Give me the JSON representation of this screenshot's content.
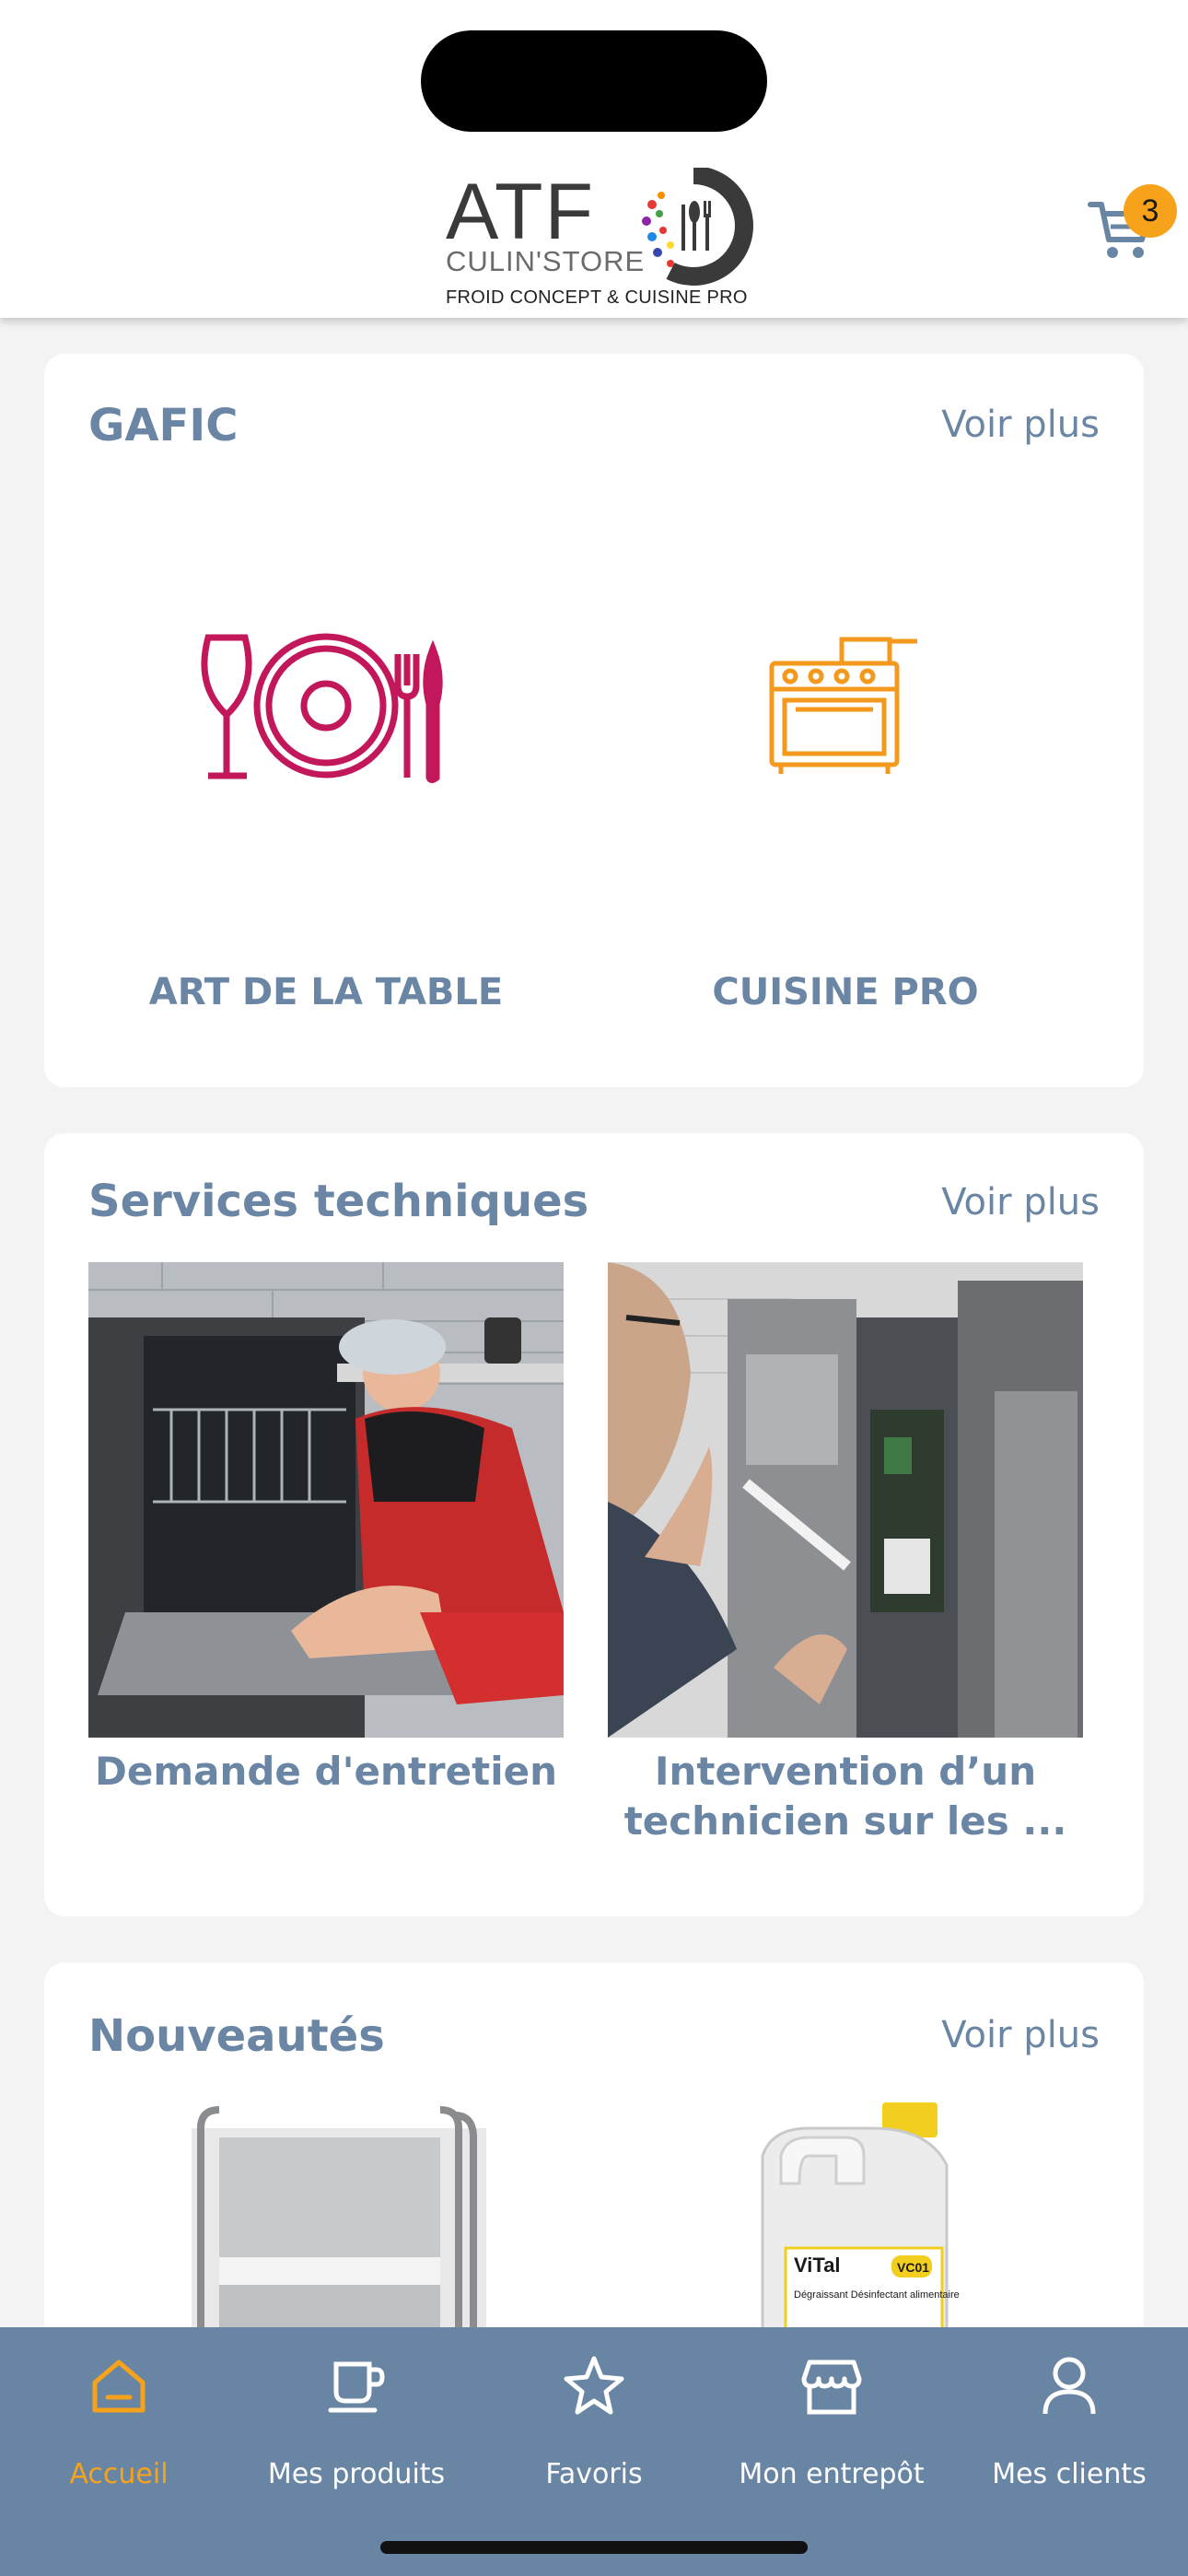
{
  "header": {
    "logo": {
      "brand": "ATF",
      "sub": "CULIN'STORE",
      "tagline": "FROID CONCEPT & CUISINE PRO"
    },
    "cart_count": "3",
    "icons": [
      "cart-icon"
    ]
  },
  "gafic": {
    "title": "GAFIC",
    "more": "Voir plus",
    "categories": [
      {
        "label": "ART DE LA TABLE",
        "icon": "tableware-icon",
        "color": "#c2185b"
      },
      {
        "label": "CUISINE PRO",
        "icon": "stove-icon",
        "color": "#f39a1e"
      }
    ]
  },
  "services": {
    "title": "Services techniques",
    "more": "Voir plus",
    "items": [
      {
        "label": "Demande d'entretien"
      },
      {
        "label": "Intervention d’un technicien sur les ..."
      }
    ]
  },
  "news": {
    "title": "Nouveautés",
    "more": "Voir plus",
    "products": [
      {
        "name": "trolley-product"
      },
      {
        "name": "detergent-product",
        "brand": "ViTal",
        "code": "VC01",
        "text": "Dégraissant Désinfectant alimentaire"
      }
    ]
  },
  "nav": {
    "items": [
      {
        "label": "Accueil",
        "icon": "home-icon",
        "active": true
      },
      {
        "label": "Mes produits",
        "icon": "cup-icon"
      },
      {
        "label": "Favoris",
        "icon": "star-icon"
      },
      {
        "label": "Mon entrepôt",
        "icon": "store-icon"
      },
      {
        "label": "Mes clients",
        "icon": "user-icon"
      }
    ],
    "active_color": "#f7a21b",
    "bg_color": "#6886a4"
  }
}
